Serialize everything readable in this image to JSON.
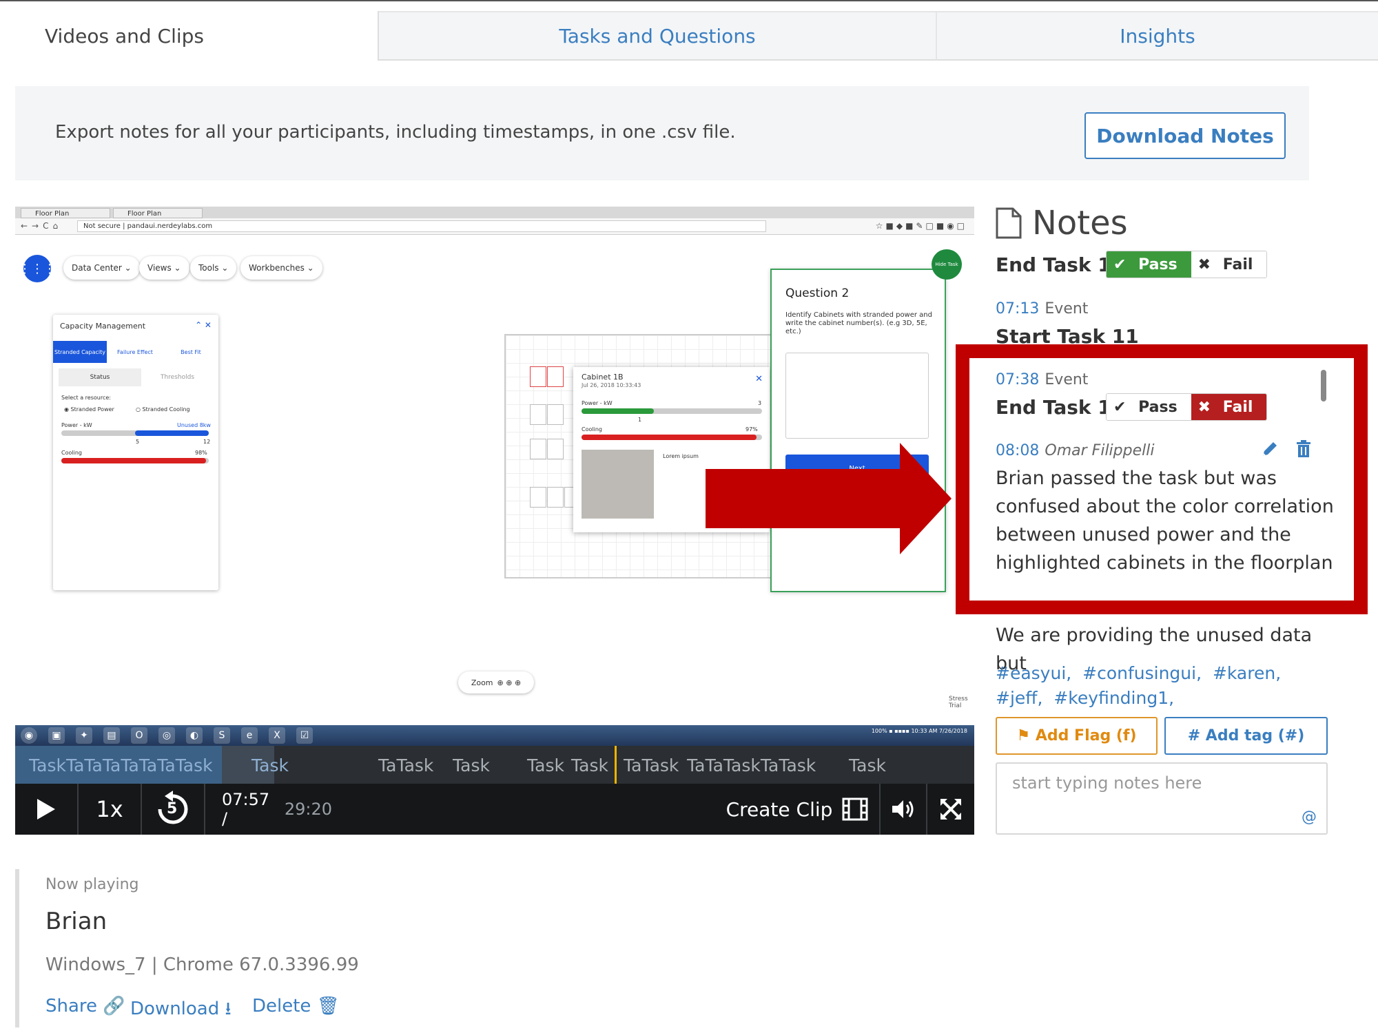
{
  "tabs": [
    {
      "label": "Videos and Clips",
      "active": true
    },
    {
      "label": "Tasks and Questions",
      "active": false
    },
    {
      "label": "Insights",
      "active": false
    }
  ],
  "export": {
    "text": "Export notes for all your participants, including timestamps, in one .csv file.",
    "button": "Download Notes"
  },
  "video_screen": {
    "browser_tabs": [
      "Floor Plan",
      "Floor Plan"
    ],
    "address": "Not secure  |  pandaui.nerdeylabs.com",
    "menus": [
      "Data Center",
      "Views",
      "Tools",
      "Workbenches"
    ],
    "capacity": {
      "title": "Capacity Management",
      "tabs": [
        "Stranded Capacity",
        "Failure Effect",
        "Best Fit"
      ],
      "sub_tabs": [
        "Status",
        "Thresholds"
      ],
      "select_label": "Select a resource:",
      "options": [
        "Stranded Power",
        "Stranded Cooling"
      ],
      "power_label": "Power - kW",
      "power_right": "Unused 8kw",
      "power_ticks": [
        "5",
        "12"
      ],
      "cooling_label": "Cooling",
      "cooling_value": "98%",
      "power_level": 0.5,
      "cooling_level": 0.98
    },
    "cabinet": {
      "title": "Cabinet 1B",
      "subtitle": "Jul 26, 2018 10:33:43",
      "power_label": "Power - kW",
      "power_value": "3",
      "power_tick": "1",
      "cooling_label": "Cooling",
      "cooling_value": "97%",
      "image_caption": "Lorem ipsum",
      "power_level": 0.4,
      "cooling_level": 0.97
    },
    "question": {
      "title": "Question 2",
      "text": "Identify Cabinets with stranded power and write the cabinet number(s). (e.g 3D, 5E, etc.)",
      "next": "Next"
    },
    "hide_task": "Hide Task",
    "zoom": "Zoom",
    "logo_text": "Stress Trial",
    "tray_badge": "100%",
    "tray_time": "10:33 AM",
    "tray_date": "7/26/2018"
  },
  "timeline": {
    "task_labels": [
      "TaskTaTaTaTaTaTaTask",
      "Task",
      "TaTask",
      "Task",
      "Task",
      "Task",
      "TaTask",
      "TaTaTaskTaTask",
      "Task"
    ],
    "played_fraction": 0.27
  },
  "controls": {
    "speed": "1x",
    "rewind": "5",
    "current_time": "07:57 /",
    "total_time": "29:20",
    "create_clip": "Create Clip"
  },
  "notes": {
    "title": "Notes",
    "entries": [
      {
        "title": "End Task 10",
        "pass": "Pass",
        "fail": "Fail",
        "result": "pass"
      },
      {
        "time": "07:13",
        "type": "Event",
        "title": "Start Task 11"
      },
      {
        "time": "07:38",
        "type": "Event",
        "title": "End Task 11",
        "pass": "Pass",
        "fail": "Fail",
        "result": "fail"
      },
      {
        "time": "08:08",
        "author": "Omar Filippelli",
        "body": "Brian passed the task but was confused about the color correlation between unused power and the highlighted cabinets in the floorplan"
      },
      {
        "body": "We are providing the unused data but"
      }
    ],
    "tags": [
      "#easyui,",
      "#confusingui,",
      "#karen,",
      "#jeff,",
      "#keyfinding1,"
    ],
    "add_flag": "Add Flag (f)",
    "add_tag": "Add tag (#)",
    "input_placeholder": "start typing notes here",
    "highlight_color": "#c00000"
  },
  "now_playing": {
    "label": "Now playing",
    "name": "Brian",
    "meta": "Windows_7 | Chrome 67.0.3396.99",
    "share": "Share",
    "download": "Download",
    "delete": "Delete"
  }
}
